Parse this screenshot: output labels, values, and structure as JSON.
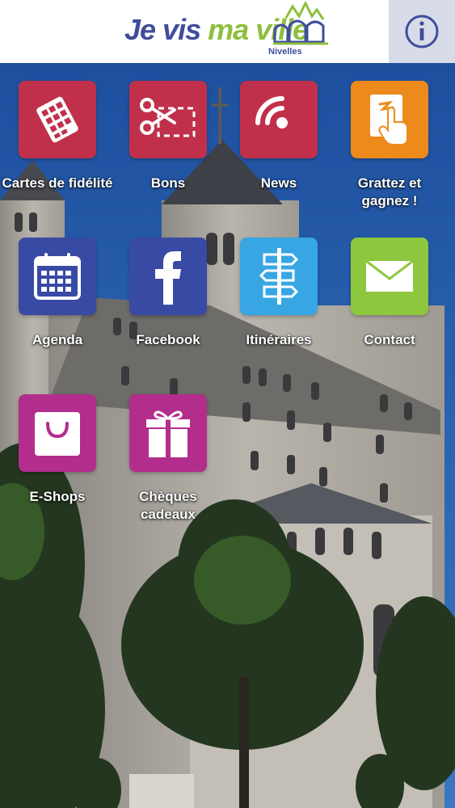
{
  "header": {
    "logo_je": "Je vis",
    "logo_mv": "ma ville",
    "logo_city": "Nivelles",
    "logo_icon": "castle-icon",
    "info_icon": "info-icon"
  },
  "colors": {
    "red": "#c1304b",
    "orange": "#ec8a1b",
    "navy": "#394aa4",
    "sky": "#37a6e3",
    "green": "#8cc73e",
    "magenta": "#b32d8c",
    "brand_blue": "#3f4d9c",
    "brand_green": "#8dbf3c"
  },
  "tiles": [
    {
      "label": "Cartes de fidélité",
      "icon": "loyalty-card-icon"
    },
    {
      "label": "Bons",
      "icon": "coupon-scissors-icon"
    },
    {
      "label": "News",
      "icon": "rss-icon"
    },
    {
      "label": "Grattez et gagnez !",
      "icon": "scratch-card-icon"
    },
    {
      "label": "Agenda",
      "icon": "calendar-icon"
    },
    {
      "label": "Facebook",
      "icon": "facebook-icon"
    },
    {
      "label": "Itinéraires",
      "icon": "signpost-icon"
    },
    {
      "label": "Contact",
      "icon": "envelope-icon"
    },
    {
      "label": "E-Shops",
      "icon": "shopping-bag-icon"
    },
    {
      "label": "Chèques cadeaux",
      "icon": "gift-icon"
    }
  ]
}
